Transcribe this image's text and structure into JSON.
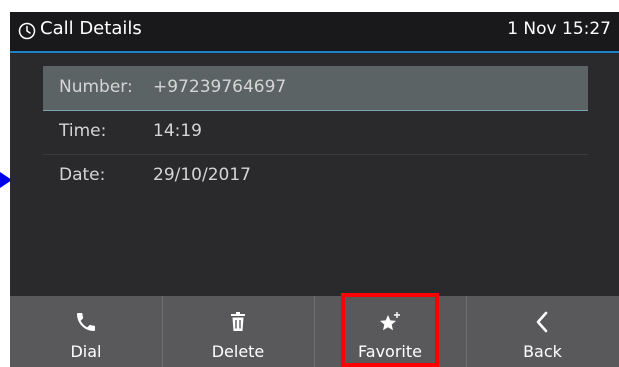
{
  "header": {
    "title": "Call Details",
    "datetime": "1 Nov 15:27",
    "icon": "clock-icon"
  },
  "details": [
    {
      "label": "Number:",
      "value": "+97239764697"
    },
    {
      "label": "Time:",
      "value": "14:19"
    },
    {
      "label": "Date:",
      "value": "29/10/2017"
    }
  ],
  "softkeys": [
    {
      "label": "Dial",
      "icon": "phone-icon"
    },
    {
      "label": "Delete",
      "icon": "trash-icon"
    },
    {
      "label": "Favorite",
      "icon": "star-plus-icon"
    },
    {
      "label": "Back",
      "icon": "chevron-left-icon"
    }
  ],
  "colors": {
    "accent": "#1e82c8",
    "highlight_box": "#ff0000",
    "pointer_arrow": "#0000ee"
  }
}
